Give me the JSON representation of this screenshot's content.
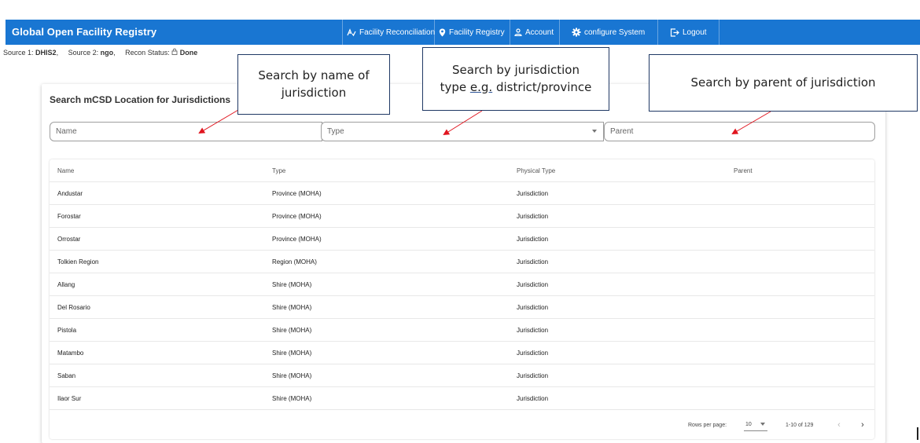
{
  "header": {
    "app_title": "Global Open Facility Registry",
    "nav": [
      {
        "label": "Facility Reconciliation",
        "icon": "reconcile-icon"
      },
      {
        "label": "Facility Registry",
        "icon": "map-pin-icon"
      },
      {
        "label": "Account",
        "icon": "person-icon"
      },
      {
        "label": "configure System",
        "icon": "gear-icon"
      },
      {
        "label": "Logout",
        "icon": "logout-icon"
      }
    ]
  },
  "status": {
    "source1_label": "Source 1:",
    "source1_value": "DHIS2",
    "source2_label": "Source 2:",
    "source2_value": "ngo",
    "recon_label": "Recon Status:",
    "recon_icon": "lock-icon",
    "recon_value": "Done"
  },
  "card": {
    "title": "Search mCSD Location for Jurisdictions"
  },
  "search": {
    "name_placeholder": "Name",
    "type_placeholder": "Type",
    "parent_placeholder": "Parent"
  },
  "table": {
    "columns": [
      "Name",
      "Type",
      "Physical Type",
      "Parent"
    ],
    "rows": [
      [
        "Andustar",
        "Province (MOHA)",
        "Jurisdiction",
        ""
      ],
      [
        "Forostar",
        "Province (MOHA)",
        "Jurisdiction",
        ""
      ],
      [
        "Orrostar",
        "Province (MOHA)",
        "Jurisdiction",
        ""
      ],
      [
        "Tolkien Region",
        "Region (MOHA)",
        "Jurisdiction",
        ""
      ],
      [
        "Allang",
        "Shire (MOHA)",
        "Jurisdiction",
        ""
      ],
      [
        "Del Rosario",
        "Shire (MOHA)",
        "Jurisdiction",
        ""
      ],
      [
        "Pistola",
        "Shire (MOHA)",
        "Jurisdiction",
        ""
      ],
      [
        "Matambo",
        "Shire (MOHA)",
        "Jurisdiction",
        ""
      ],
      [
        "Saban",
        "Shire (MOHA)",
        "Jurisdiction",
        ""
      ],
      [
        "Ilaor Sur",
        "Shire (MOHA)",
        "Jurisdiction",
        ""
      ]
    ],
    "footer": {
      "rows_per_page_label": "Rows per page:",
      "rows_per_page_value": "10",
      "range": "1-10 of 129",
      "prev_icon": "chevron-left-icon",
      "next_icon": "chevron-right-icon"
    }
  },
  "callouts": {
    "name": {
      "line1": "Search by name of",
      "line2": "jurisdiction"
    },
    "type": {
      "line1": "Search by jurisdiction",
      "line2_pre": "type ",
      "line2_eg": "e.g.",
      "line2_post": " district/province"
    },
    "parent": {
      "text": "Search by parent of jurisdiction"
    }
  },
  "colors": {
    "appbar": "#1976d2",
    "callout_border": "#1f3864",
    "arrow": "#e0141e"
  }
}
